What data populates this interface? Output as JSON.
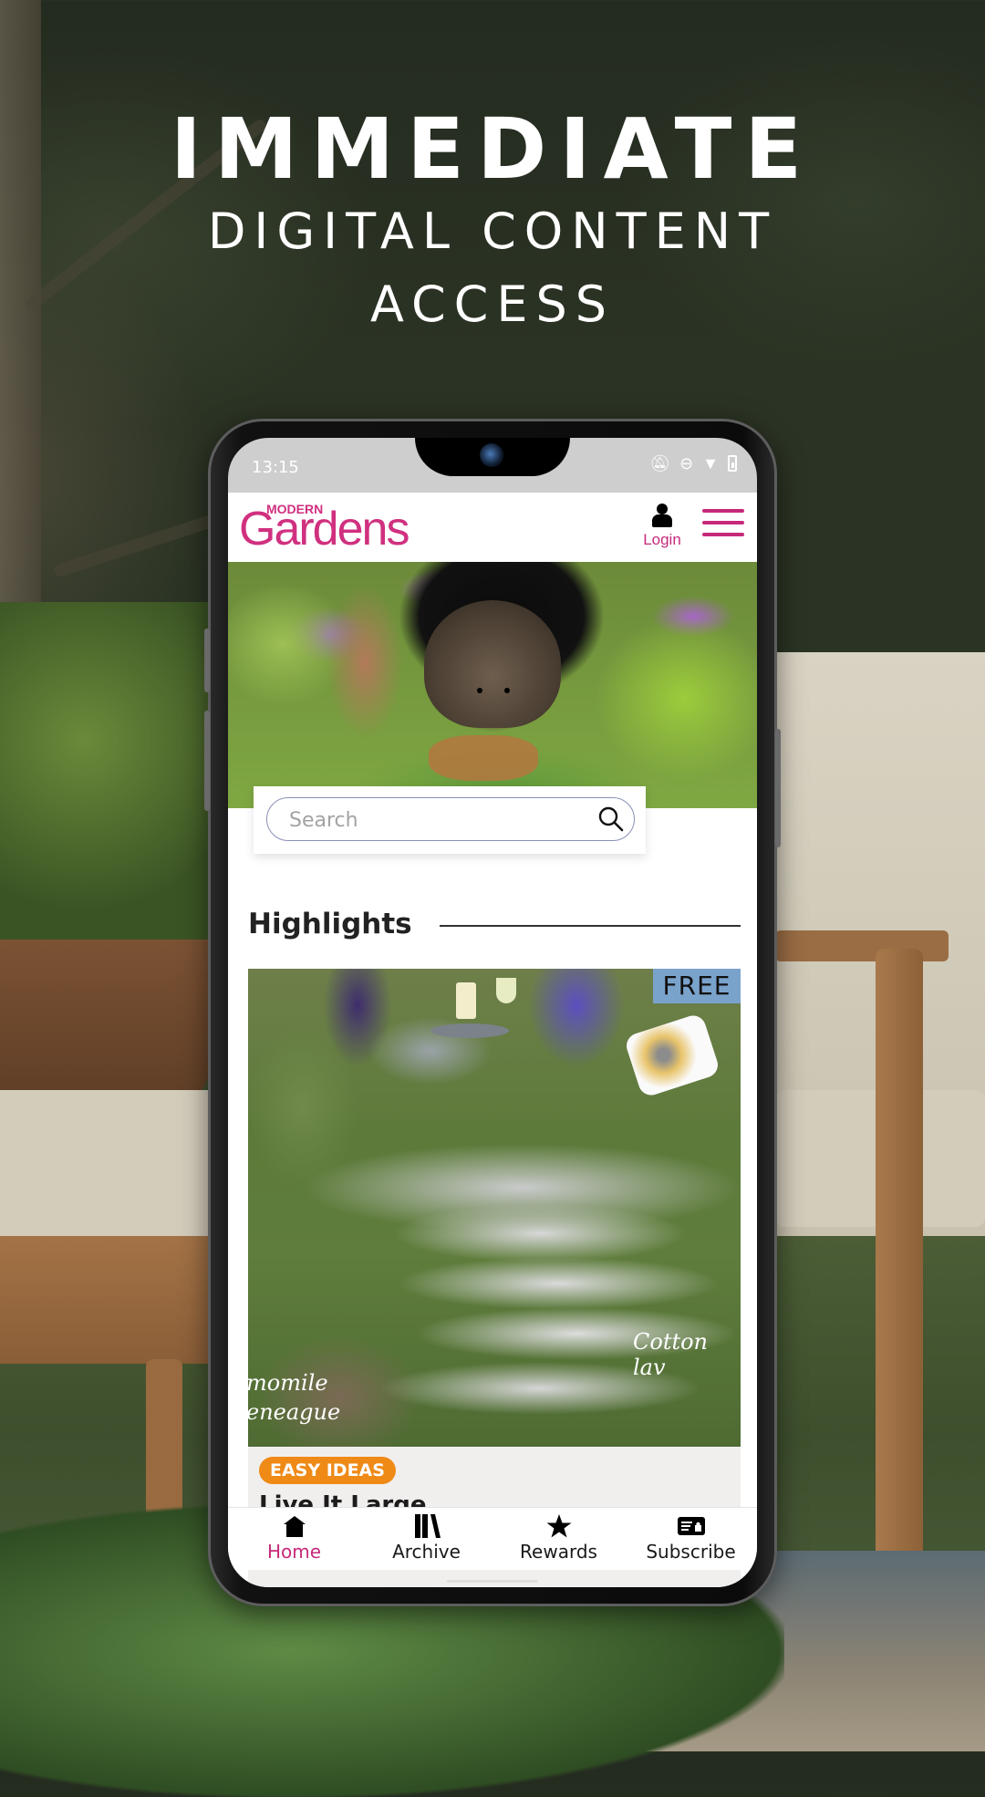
{
  "promo": {
    "line1": "IMMEDIATE",
    "line2": "DIGITAL CONTENT",
    "line3": "ACCESS"
  },
  "statusbar": {
    "time": "13:15",
    "icons": [
      "notifications-off-icon",
      "do-not-disturb-icon",
      "wifi-icon",
      "battery-charging-icon"
    ]
  },
  "header": {
    "logo_small": "MODERN",
    "logo_large": "Gardens",
    "login_label": "Login",
    "brand_color": "#c7297a"
  },
  "search": {
    "placeholder": "Search",
    "value": ""
  },
  "highlights": {
    "title": "Highlights",
    "card": {
      "badge": "FREE",
      "annotations": [
        "momile",
        "eneague",
        "Cotton lav"
      ],
      "tag": "EASY IDEAS",
      "tag_color": "#ef8a17",
      "title": "Live It Large"
    }
  },
  "nav": {
    "items": [
      {
        "label": "Home",
        "icon": "home-icon",
        "active": true
      },
      {
        "label": "Archive",
        "icon": "archive-icon",
        "active": false
      },
      {
        "label": "Rewards",
        "icon": "star-icon",
        "active": false
      },
      {
        "label": "Subscribe",
        "icon": "subscribe-icon",
        "active": false
      }
    ]
  }
}
